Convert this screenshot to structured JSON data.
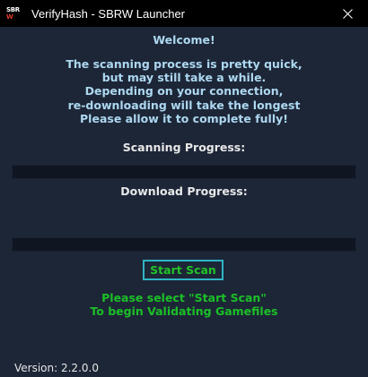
{
  "window": {
    "icon": "sbrw-logo-icon",
    "icon_text_top": "SBR",
    "icon_text_bottom": "W",
    "title": "VerifyHash - SBRW Launcher",
    "close_icon": "close-icon"
  },
  "content": {
    "welcome": "Welcome!",
    "message_lines": [
      "The scanning process is pretty quick,",
      "but may still take a while.",
      "Depending on your connection,",
      "re-downloading will take the longest",
      "Please allow it to complete fully!"
    ],
    "scanning_label": "Scanning Progress:",
    "scanning_progress": 0,
    "download_label": "Download Progress:",
    "download_progress": 0,
    "start_scan_label": "Start Scan",
    "status_lines": [
      "Please select \"Start Scan\"",
      "To begin Validating Gamefiles"
    ],
    "version": "Version: 2.2.0.0"
  },
  "colors": {
    "background": "#1d2637",
    "title_bar": "#000000",
    "message_text": "#add8f0",
    "status_text": "#1bbf27",
    "button_border": "#2fb4c4",
    "button_text": "#22c32a"
  }
}
